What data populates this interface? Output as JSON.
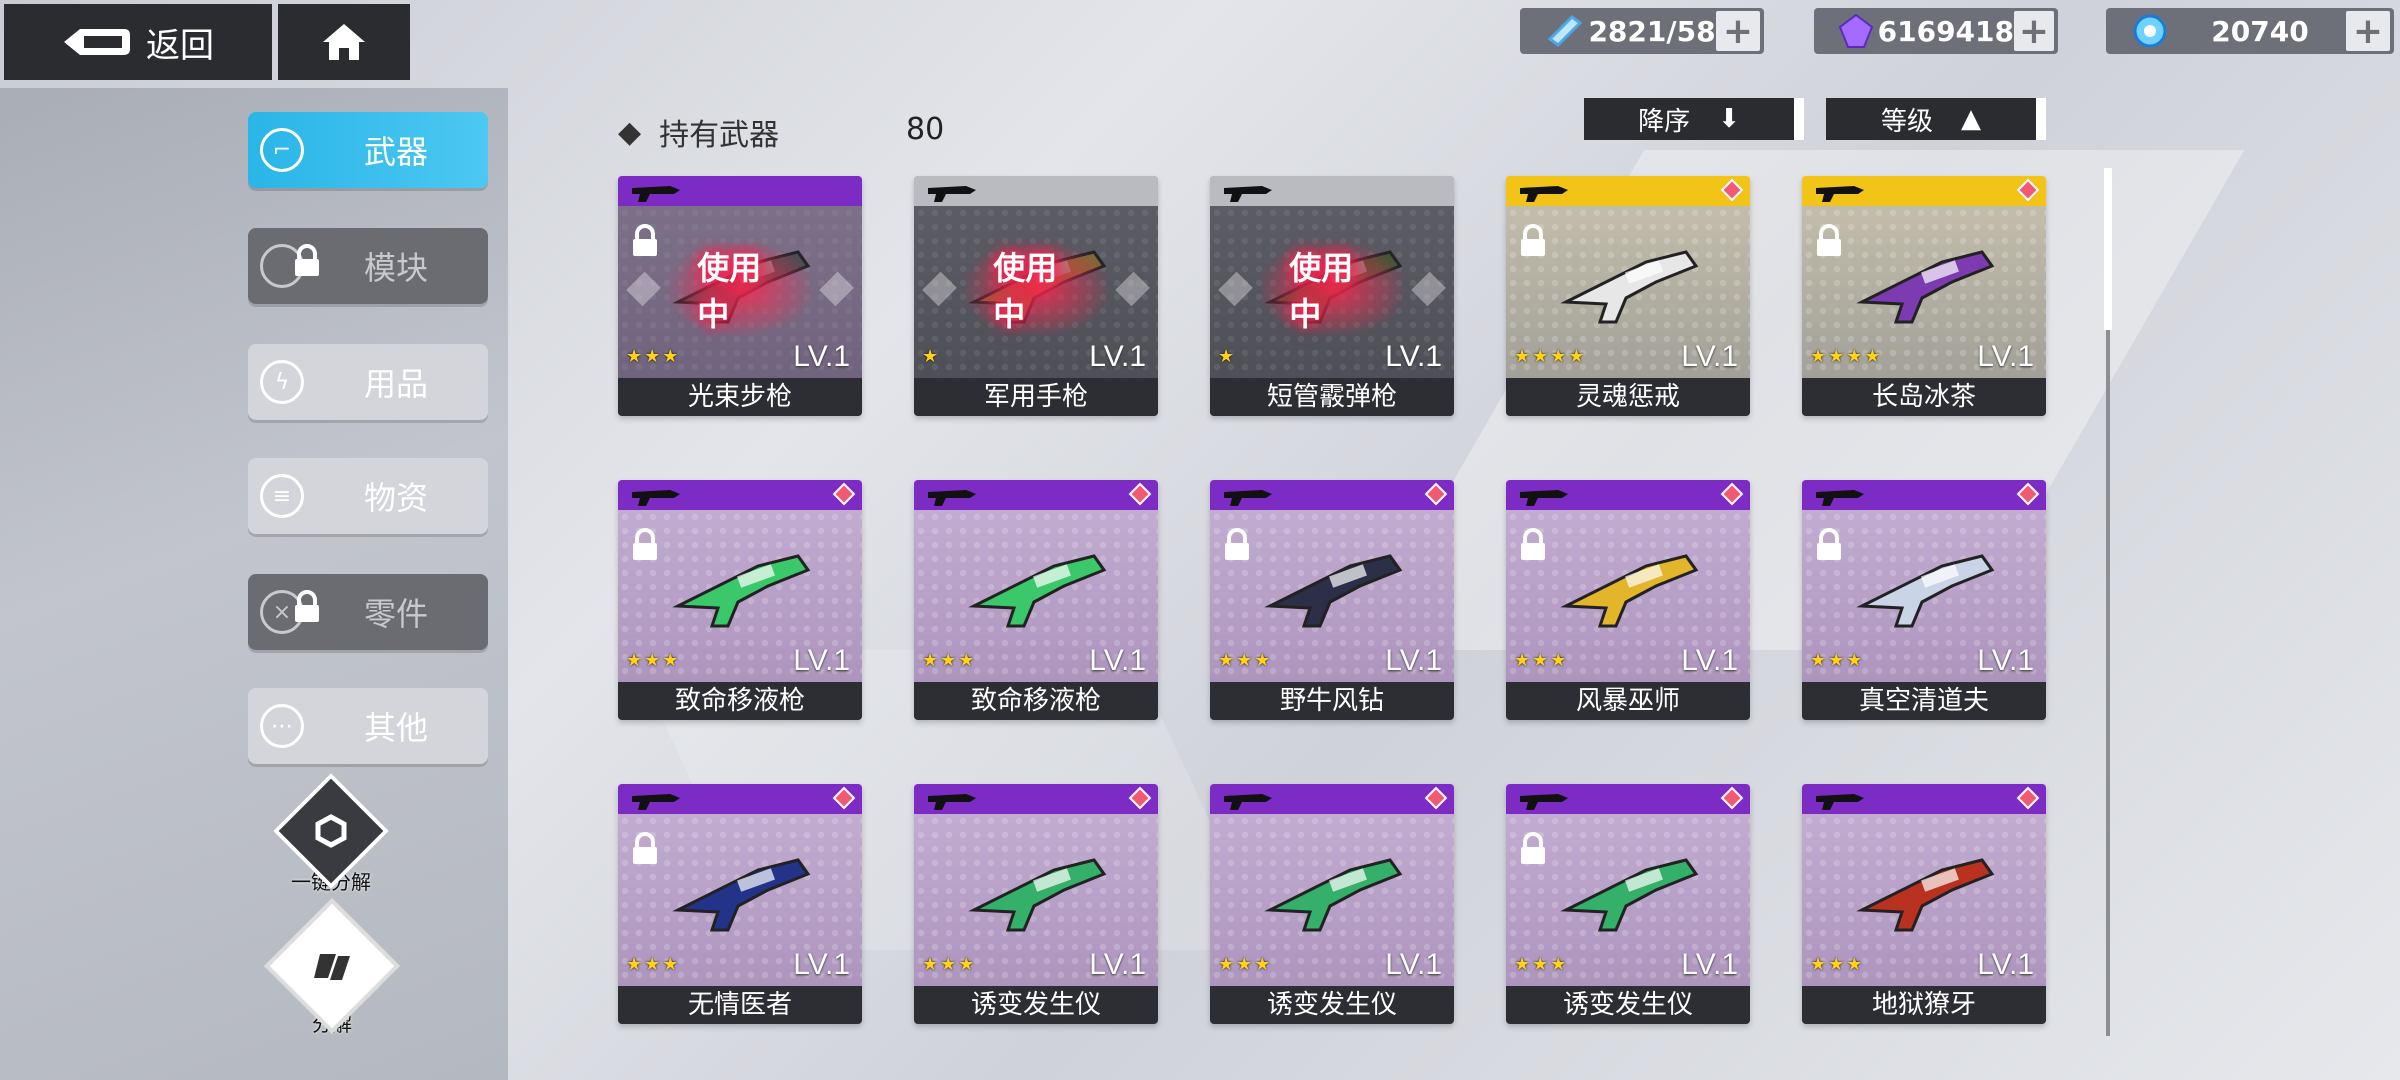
{
  "header": {
    "back_label": "返回",
    "resources": [
      {
        "icon": "stamina-crystal-icon",
        "value": "2821/58"
      },
      {
        "icon": "purple-gem-icon",
        "value": "6169418"
      },
      {
        "icon": "energy-orb-icon",
        "value": "20740"
      }
    ],
    "plus_label": "+"
  },
  "sidebar": {
    "categories": [
      {
        "label": "武器",
        "icon": "gun-icon",
        "state": "active"
      },
      {
        "label": "模块",
        "icon": "module-icon",
        "state": "locked"
      },
      {
        "label": "用品",
        "icon": "lightning-icon",
        "state": "normal"
      },
      {
        "label": "物资",
        "icon": "supply-icon",
        "state": "normal"
      },
      {
        "label": "零件",
        "icon": "parts-icon",
        "state": "locked"
      },
      {
        "label": "其他",
        "icon": "more-icon",
        "state": "normal"
      }
    ],
    "one_click_dismantle": "一键分解",
    "dismantle": "分解"
  },
  "content": {
    "heading": "持有武器",
    "count": "80",
    "sort_order": "降序",
    "sort_by": "等级",
    "in_use_label": "使用中",
    "weapons": [
      {
        "name": "光束步枪",
        "level": "LV.1",
        "stars": 3,
        "rarity": "purple",
        "in_use": true,
        "locked": true
      },
      {
        "name": "军用手枪",
        "level": "LV.1",
        "stars": 1,
        "rarity": "gray",
        "in_use": true,
        "locked": false
      },
      {
        "name": "短管霰弹枪",
        "level": "LV.1",
        "stars": 1,
        "rarity": "gray",
        "in_use": true,
        "locked": false
      },
      {
        "name": "灵魂惩戒",
        "level": "LV.1",
        "stars": 4,
        "rarity": "gold",
        "in_use": false,
        "locked": true
      },
      {
        "name": "长岛冰茶",
        "level": "LV.1",
        "stars": 4,
        "rarity": "gold",
        "in_use": false,
        "locked": true
      },
      {
        "name": "致命移液枪",
        "level": "LV.1",
        "stars": 3,
        "rarity": "purple",
        "in_use": false,
        "locked": true
      },
      {
        "name": "致命移液枪",
        "level": "LV.1",
        "stars": 3,
        "rarity": "purple",
        "in_use": false,
        "locked": false
      },
      {
        "name": "野牛风钻",
        "level": "LV.1",
        "stars": 3,
        "rarity": "purple",
        "in_use": false,
        "locked": true
      },
      {
        "name": "风暴巫师",
        "level": "LV.1",
        "stars": 3,
        "rarity": "purple",
        "in_use": false,
        "locked": true
      },
      {
        "name": "真空清道夫",
        "level": "LV.1",
        "stars": 3,
        "rarity": "purple",
        "in_use": false,
        "locked": true
      },
      {
        "name": "无情医者",
        "level": "LV.1",
        "stars": 3,
        "rarity": "purple",
        "in_use": false,
        "locked": true
      },
      {
        "name": "诱变发生仪",
        "level": "LV.1",
        "stars": 3,
        "rarity": "purple",
        "in_use": false,
        "locked": false
      },
      {
        "name": "诱变发生仪",
        "level": "LV.1",
        "stars": 3,
        "rarity": "purple",
        "in_use": false,
        "locked": false
      },
      {
        "name": "诱变发生仪",
        "level": "LV.1",
        "stars": 3,
        "rarity": "purple",
        "in_use": false,
        "locked": true
      },
      {
        "name": "地狱獠牙",
        "level": "LV.1",
        "stars": 3,
        "rarity": "purple",
        "in_use": false,
        "locked": false
      }
    ]
  }
}
